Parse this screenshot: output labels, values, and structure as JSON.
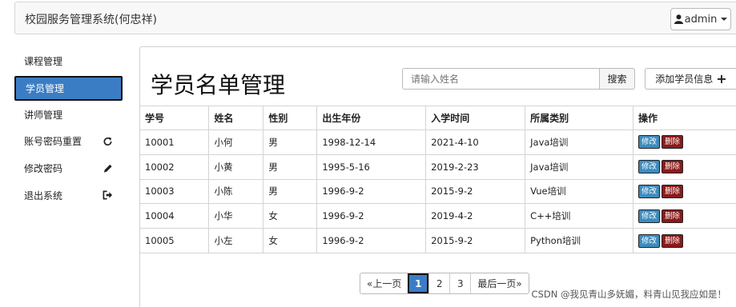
{
  "header": {
    "title": "校园服务管理系统(何忠祥)",
    "user_label": "admin"
  },
  "sidebar": {
    "items": [
      {
        "label": "课程管理",
        "icon": ""
      },
      {
        "label": "学员管理",
        "icon": ""
      },
      {
        "label": "讲师管理",
        "icon": ""
      },
      {
        "label": "账号密码重置",
        "icon": "refresh-icon"
      },
      {
        "label": "修改密码",
        "icon": "pencil-icon"
      },
      {
        "label": "退出系统",
        "icon": "logout-icon"
      }
    ]
  },
  "main": {
    "title": "学员名单管理",
    "search_placeholder": "请输入姓名",
    "search_label": "搜索",
    "add_label": "添加学员信息"
  },
  "table": {
    "headers": [
      "学号",
      "姓名",
      "性别",
      "出生年份",
      "入学时间",
      "所属类别",
      "操作"
    ],
    "rows": [
      [
        "10001",
        "小何",
        "男",
        "1998-12-14",
        "2021-4-10",
        "Java培训"
      ],
      [
        "10002",
        "小黄",
        "男",
        "1995-5-16",
        "2019-2-23",
        "Java培训"
      ],
      [
        "10003",
        "小陈",
        "男",
        "1996-9-2",
        "2015-9-2",
        "Vue培训"
      ],
      [
        "10004",
        "小华",
        "女",
        "1996-9-2",
        "2019-4-2",
        "C++培训"
      ],
      [
        "10005",
        "小左",
        "女",
        "1996-9-2",
        "2015-9-2",
        "Python培训"
      ]
    ],
    "edit_label": "修改",
    "delete_label": "删除"
  },
  "pagination": {
    "prev_label": "«上一页",
    "pages": [
      "1",
      "2",
      "3"
    ],
    "active_page": "1",
    "last_label": "最后一页»"
  },
  "watermark": "CSDN @我见青山多妩媚，料青山见我应如是！",
  "colors": {
    "accent": "#3b7dc4",
    "edit_button": "#3e8bbd",
    "delete_button": "#8b1a1a"
  }
}
